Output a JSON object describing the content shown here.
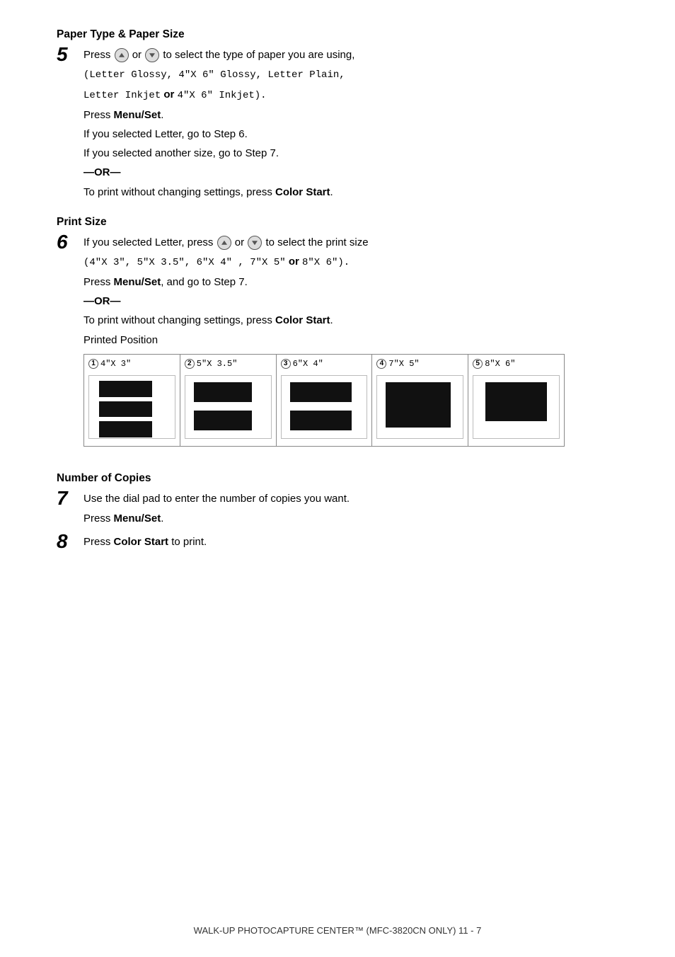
{
  "page": {
    "title": "Paper Type & Paper Size",
    "title2": "Print Size",
    "title3": "Number of Copies",
    "footer": "WALK-UP PHOTOCAPTURE CENTER™ (MFC-3820CN ONLY)   11 - 7"
  },
  "step5": {
    "num": "5",
    "line1_pre": "Press ",
    "line1_icons": [
      "up",
      "down"
    ],
    "line1_post": " to select the type of paper you are using,",
    "code_line1": "(Letter Glossy, 4\"X 6\" Glossy, Letter Plain,",
    "code_line2": "Letter Inkjet",
    "or_inline": "or",
    "code_line2b": " 4\"X 6\" Inkjet).",
    "press_menu": "Press ",
    "menu_bold": "Menu/Set",
    "press_menu_end": ".",
    "if_letter": "If you selected Letter, go to Step 6.",
    "if_another": "If you selected another size, go to Step 7.",
    "or_line": "—OR—",
    "to_print": "To print without changing settings, press ",
    "color_start": "Color Start",
    "to_print_end": "."
  },
  "step6": {
    "num": "6",
    "line1_pre": "If you selected Letter, press ",
    "line1_icons": [
      "up",
      "down"
    ],
    "line1_post": " to select the print size",
    "code_line": "(4\"X 3\", 5\"X 3.5\", 6\"X 4\" , 7\"X 5\"",
    "or_inline": "or",
    "code_line2": " 8\"X 6\").",
    "press_menu": "Press ",
    "menu_bold": "Menu/Set",
    "press_and": ", and go to Step 7.",
    "or_line": "—OR—",
    "to_print": "To print without changing settings, press ",
    "color_start": "Color Start",
    "to_print_end": ".",
    "printed_position": "Printed Position"
  },
  "positions": [
    {
      "num": "1",
      "label": "4\"X 3\""
    },
    {
      "num": "2",
      "label": "5\"X 3.5\""
    },
    {
      "num": "3",
      "label": "6\"X 4\""
    },
    {
      "num": "4",
      "label": "7\"X 5\""
    },
    {
      "num": "5",
      "label": "8\"X 6\""
    }
  ],
  "step7": {
    "num": "7",
    "line1": "Use the dial pad to enter the number of copies you want.",
    "press_menu": "Press ",
    "menu_bold": "Menu/Set",
    "press_menu_end": "."
  },
  "step8": {
    "num": "8",
    "line1_pre": "Press ",
    "color_start": "Color Start",
    "line1_post": " to print."
  }
}
